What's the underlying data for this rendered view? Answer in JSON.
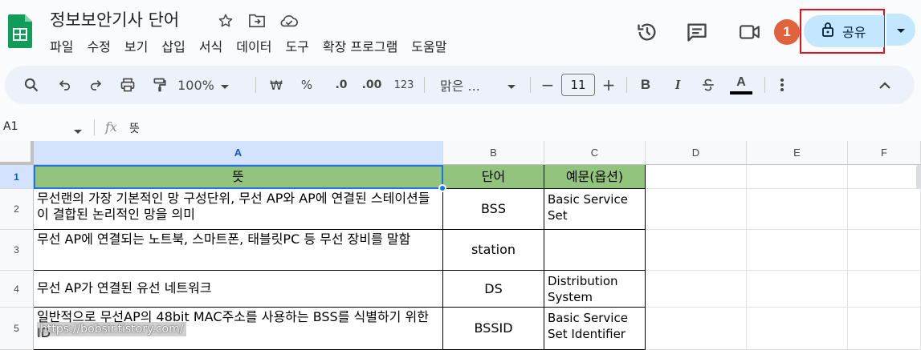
{
  "header": {
    "title": "정보보안기사 단어",
    "menu": [
      "파일",
      "수정",
      "보기",
      "삽입",
      "서식",
      "데이터",
      "도구",
      "확장 프로그램",
      "도움말"
    ],
    "badge": "1",
    "share_label": "공유"
  },
  "toolbar": {
    "zoom": "100%",
    "currency": "₩",
    "percent": "%",
    "dec_decrease": ".0",
    "dec_increase": ".00",
    "number_format": "123",
    "font": "맑은 ...",
    "font_size": "11",
    "minus": "−",
    "plus": "+",
    "bold": "B",
    "italic": "I",
    "text_color": "A"
  },
  "formula_bar": {
    "cell_ref": "A1",
    "fx": "fx",
    "value": "뜻"
  },
  "grid": {
    "columns": [
      "A",
      "B",
      "C",
      "D",
      "E",
      "F"
    ],
    "rows": [
      {
        "num": "1",
        "a": "뜻",
        "b": "단어",
        "c": "예문(옵션)"
      },
      {
        "num": "2",
        "a": "무선랜의 가장 기본적인 망 구성단위, 무선 AP와 AP에 연결된 스테이션들이 결합된 논리적인 망을 의미",
        "b": "BSS",
        "c": "Basic Service Set"
      },
      {
        "num": "3",
        "a": "무선 AP에 연결되는 노트북, 스마트폰, 태블릿PC 등 무선 장비를 말함",
        "b": "station",
        "c": ""
      },
      {
        "num": "4",
        "a": "무선 AP가 연결된 유선 네트워크",
        "b": "DS",
        "c": "Distribution System"
      },
      {
        "num": "5",
        "a": "일반적으로 무선AP의 48bit MAC주소를 사용하는 BSS를 식별하기 위한 ID",
        "b": "BSSID",
        "c": "Basic Service Set Identifier"
      }
    ]
  },
  "watermark": "https://bobsir.tistory.com/",
  "colors": {
    "header_green": "#93c47d",
    "share_bg": "#c2e7ff",
    "highlight_red": "#e8101c",
    "badge": "#e0633d",
    "selection": "#1a73e8"
  }
}
